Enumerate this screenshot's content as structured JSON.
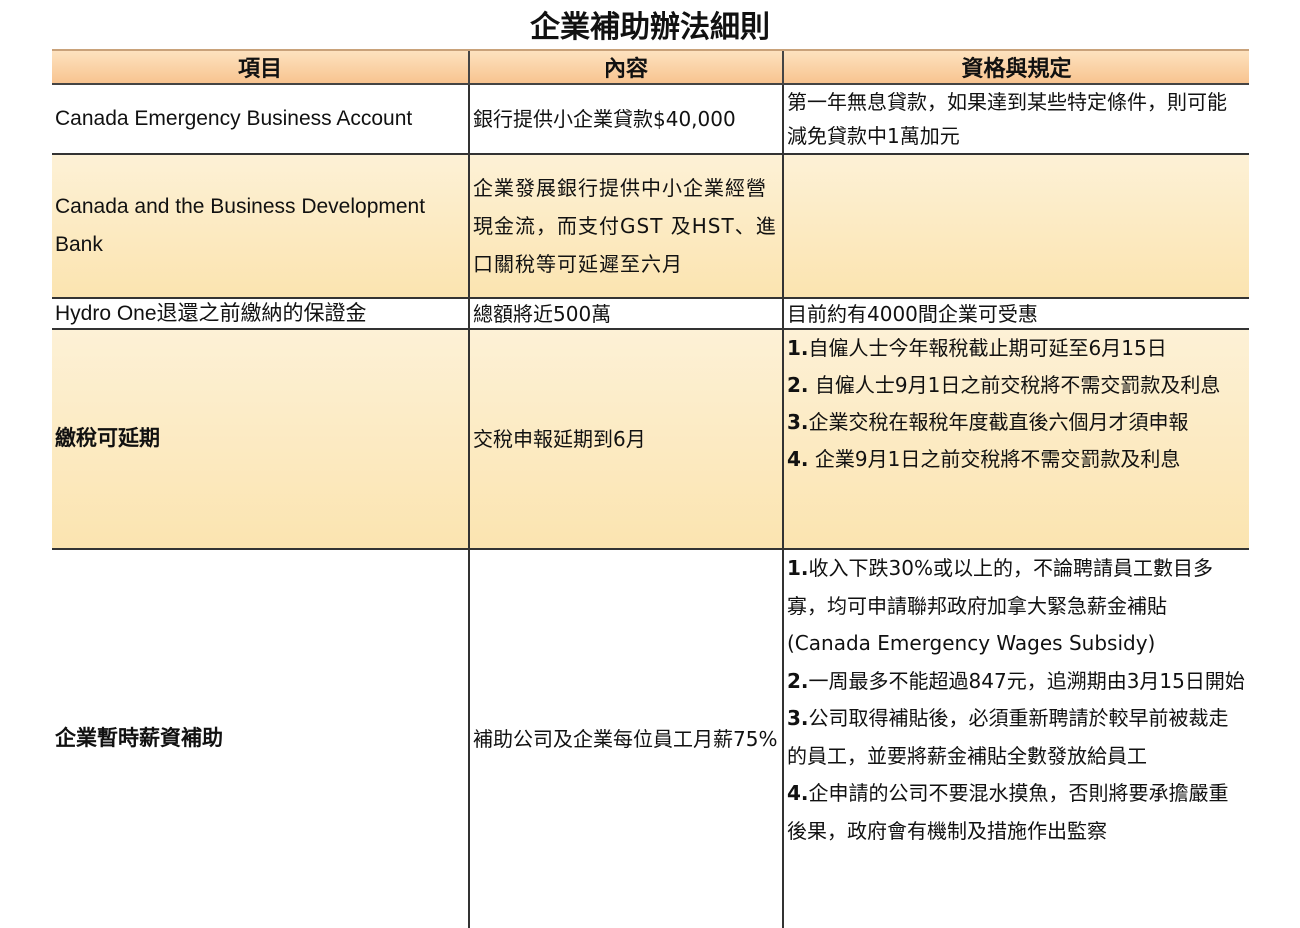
{
  "title": "企業補助辦法細則",
  "headers": [
    "項目",
    "內容",
    "資格與規定"
  ],
  "rows": [
    {
      "item": "Canada Emergency Business Account",
      "content": "銀行提供小企業貸款$40,000",
      "rules": [
        "第一年無息貸款，如果達到某些特定條件，則可能減免貸款中1萬加元"
      ]
    },
    {
      "item": "Canada and the Business Development Bank",
      "content": "企業發展銀行提供中小企業經營現金流，而支付GST 及HST、進口關稅等可延遲至六月",
      "rules": []
    },
    {
      "item": "Hydro One退還之前繳納的保證金",
      "content": "總額將近500萬",
      "rules": [
        "目前約有4000間企業可受惠"
      ]
    },
    {
      "item": "繳稅可延期",
      "content": "交稅申報延期到6月",
      "rules": [
        {
          "num": "1.",
          "text": "自僱人士今年報稅截止期可延至6月15日"
        },
        {
          "num": "2.",
          "text": " 自僱人士9月1日之前交稅將不需交罰款及利息"
        },
        {
          "num": "3.",
          "text": "企業交稅在報稅年度截直後六個月才須申報"
        },
        {
          "num": "4.",
          "text": " 企業9月1日之前交稅將不需交罰款及利息"
        }
      ]
    },
    {
      "item": "企業暫時薪資補助",
      "content": "補助公司及企業每位員工月薪75%",
      "rules": [
        {
          "num": "1.",
          "text": "收入下跌30%或以上的，不論聘請員工數目多寡，均可申請聯邦政府加拿大緊急薪金補貼(Canada Emergency Wages Subsidy)"
        },
        {
          "num": "2.",
          "text": "一周最多不能超過847元，追溯期由3月15日開始"
        },
        {
          "num": "3.",
          "text": "公司取得補貼後，必須重新聘請於較早前被裁走的員工，並要將薪金補貼全數發放給員工"
        },
        {
          "num": "4.",
          "text": "企申請的公司不要混水摸魚，否則將要承擔嚴重後果，政府會有機制及措施作出監察"
        }
      ]
    }
  ]
}
